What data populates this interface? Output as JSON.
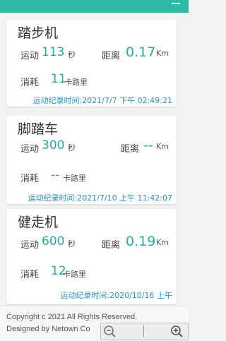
{
  "records": [
    {
      "name": "踏步机",
      "duration_label": "运动",
      "duration_value": "113",
      "duration_unit": "秒",
      "distance_label": "距离",
      "distance_value": "0.17",
      "distance_unit": "Km",
      "calories_label": "消耗",
      "calories_value": "11",
      "calories_unit": "卡路里",
      "time_text": "运动纪录时间:2021/7/7 下午 02:49:21"
    },
    {
      "name": "脚踏车",
      "duration_label": "运动",
      "duration_value": "300",
      "duration_unit": "秒",
      "distance_label": "距离",
      "distance_value": "--",
      "distance_unit": "Km",
      "calories_label": "消耗",
      "calories_value": "--",
      "calories_unit": "卡路里",
      "time_text": "运动纪录时间:2021/7/10 上午 11:42:07"
    },
    {
      "name": "健走机",
      "duration_label": "运动",
      "duration_value": "600",
      "duration_unit": "秒",
      "distance_label": "距离",
      "distance_value": "0.19",
      "distance_unit": "Km",
      "calories_label": "消耗",
      "calories_value": "12",
      "calories_unit": "卡路里",
      "time_text": "运动纪录时间:2020/10/16 上午"
    }
  ],
  "footer": {
    "copyright": "Copyright c 2021 All Rights Reserved.",
    "designed_by": "Designed by Netown Co"
  },
  "colors": {
    "accent": "#2fb8a3",
    "value_text": "#2aa89a",
    "timestamp_text": "#2a8fc5"
  },
  "icons": [
    "menu-dash-icon",
    "zoom-out-icon",
    "zoom-in-icon"
  ]
}
